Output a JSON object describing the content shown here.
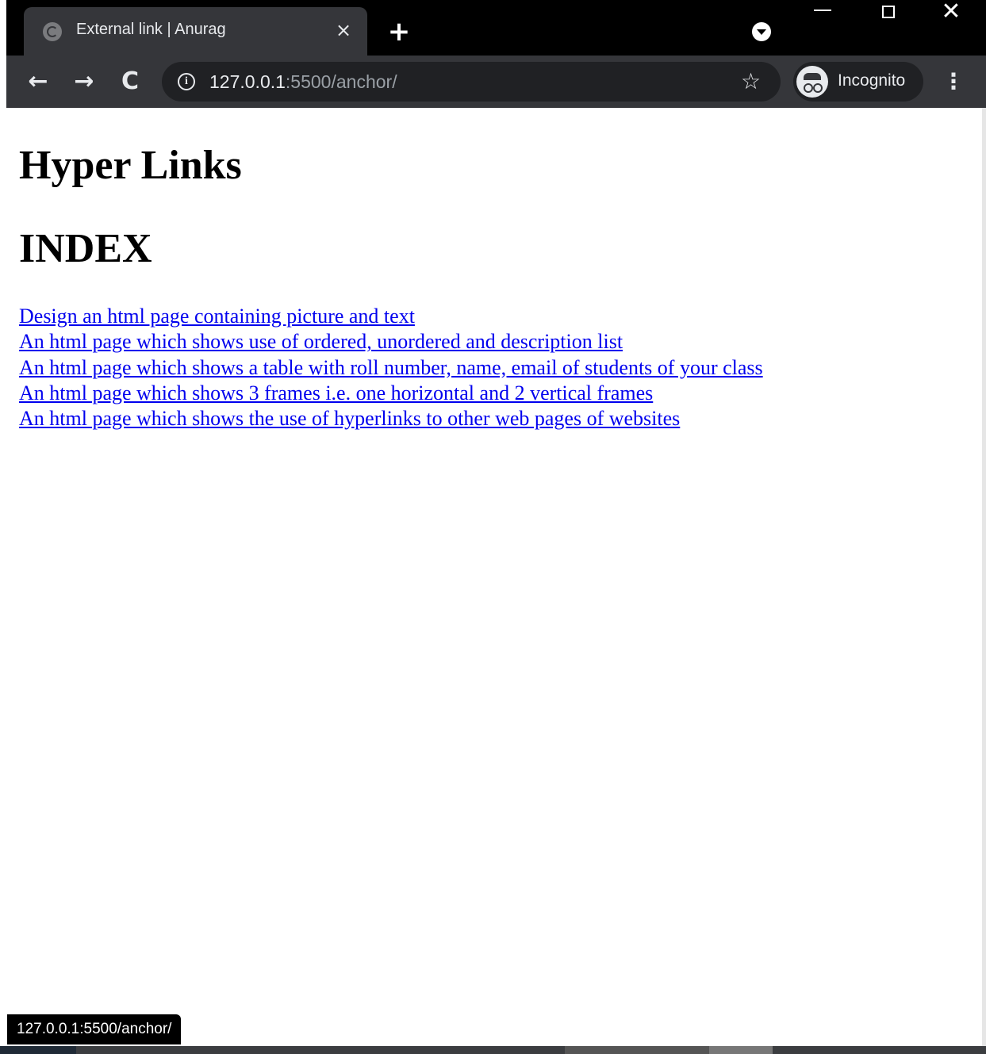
{
  "browser": {
    "tab": {
      "title": "External link | Anurag",
      "favicon": "globe-icon",
      "close": "×"
    },
    "new_tab": "+",
    "window_controls": {
      "close": "✕"
    },
    "nav": {
      "back": "←",
      "forward": "→",
      "reload": "C"
    },
    "address": {
      "info": "i",
      "host": "127.0.0.1",
      "path": ":5500/anchor/"
    },
    "bookmark": "☆",
    "profile": {
      "label": "Incognito",
      "icon": "incognito-icon"
    },
    "menu": "⋮"
  },
  "page": {
    "heading": "Hyper Links",
    "subheading": "INDEX",
    "links": [
      "Design an html page containing picture and text",
      "An html page which shows use of ordered, unordered and description list",
      "An html page which shows a table with roll number, name, email of students of your class",
      "An html page which shows 3 frames i.e. one horizontal and 2 vertical frames",
      "An html page which shows the use of hyperlinks to other web pages of websites"
    ],
    "link_color": "#0000ee"
  },
  "status_bar": {
    "url": "127.0.0.1:5500/anchor/"
  }
}
